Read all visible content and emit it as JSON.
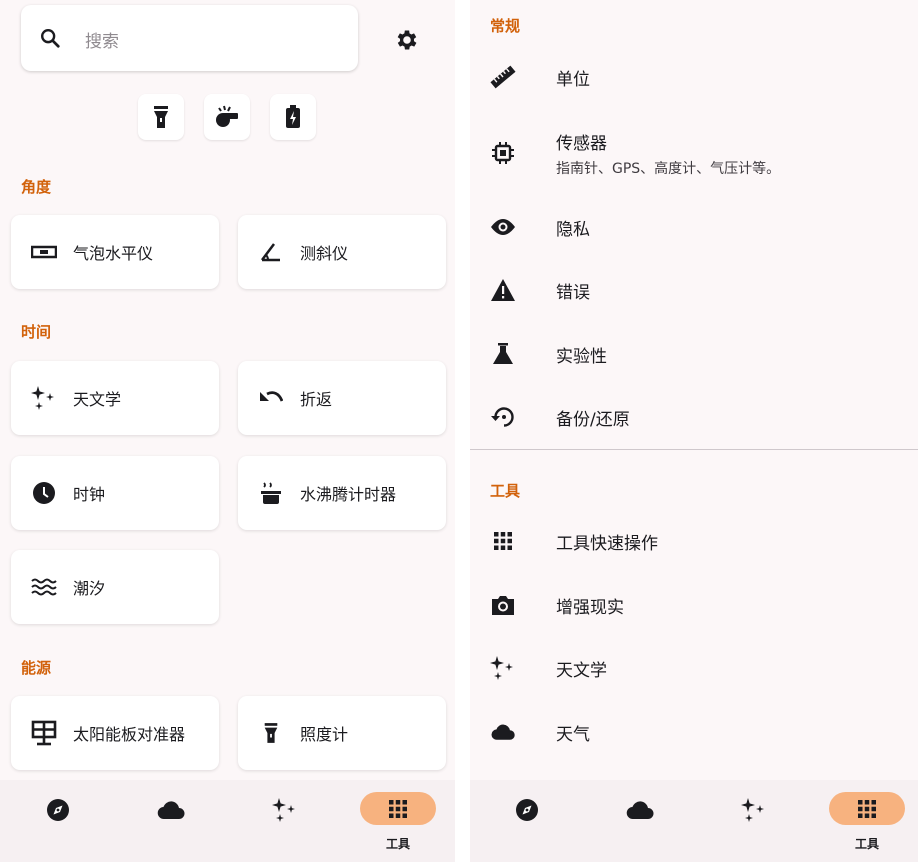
{
  "left": {
    "search": {
      "placeholder": "搜索",
      "icon": "search-icon"
    },
    "settings_icon": "gear-icon",
    "quick_actions": [
      {
        "icon": "flashlight-icon"
      },
      {
        "icon": "whistle-icon"
      },
      {
        "icon": "battery-charging-icon"
      }
    ],
    "sections": [
      {
        "title": "角度",
        "tools": [
          {
            "label": "气泡水平仪",
            "icon": "level-icon"
          },
          {
            "label": "测斜仪",
            "icon": "angle-icon"
          }
        ]
      },
      {
        "title": "时间",
        "tools": [
          {
            "label": "天文学",
            "icon": "sparkle-icon"
          },
          {
            "label": "折返",
            "icon": "undo-icon"
          },
          {
            "label": "时钟",
            "icon": "clock-icon"
          },
          {
            "label": "水沸腾计时器",
            "icon": "boiling-pot-icon"
          },
          {
            "label": "潮汐",
            "icon": "waves-icon"
          }
        ]
      },
      {
        "title": "能源",
        "tools": [
          {
            "label": "太阳能板对准器",
            "icon": "solar-panel-icon"
          },
          {
            "label": "照度计",
            "icon": "flashlight-icon"
          }
        ]
      }
    ]
  },
  "right": {
    "sections": [
      {
        "title": "常规",
        "items": [
          {
            "title": "单位",
            "icon": "ruler-icon"
          },
          {
            "title": "传感器",
            "subtitle": "指南针、GPS、高度计、气压计等。",
            "icon": "chip-icon"
          },
          {
            "title": "隐私",
            "icon": "eye-icon"
          },
          {
            "title": "错误",
            "icon": "warning-icon"
          },
          {
            "title": "实验性",
            "icon": "flask-icon"
          },
          {
            "title": "备份/还原",
            "icon": "restore-icon"
          }
        ]
      },
      {
        "title": "工具",
        "items": [
          {
            "title": "工具快速操作",
            "icon": "grid-icon"
          },
          {
            "title": "增强现实",
            "icon": "camera-icon"
          },
          {
            "title": "天文学",
            "icon": "sparkle-icon"
          },
          {
            "title": "天气",
            "icon": "cloud-icon"
          }
        ]
      }
    ]
  },
  "bottom_nav": {
    "items": [
      {
        "icon": "compass-icon",
        "label": ""
      },
      {
        "icon": "cloud-icon",
        "label": ""
      },
      {
        "icon": "sparkle-icon",
        "label": ""
      },
      {
        "icon": "grid-icon",
        "label": "工具",
        "active": true
      }
    ]
  },
  "colors": {
    "accent": "#d2620b",
    "active_pill": "#f7b27f",
    "background": "#fcf7f8"
  }
}
